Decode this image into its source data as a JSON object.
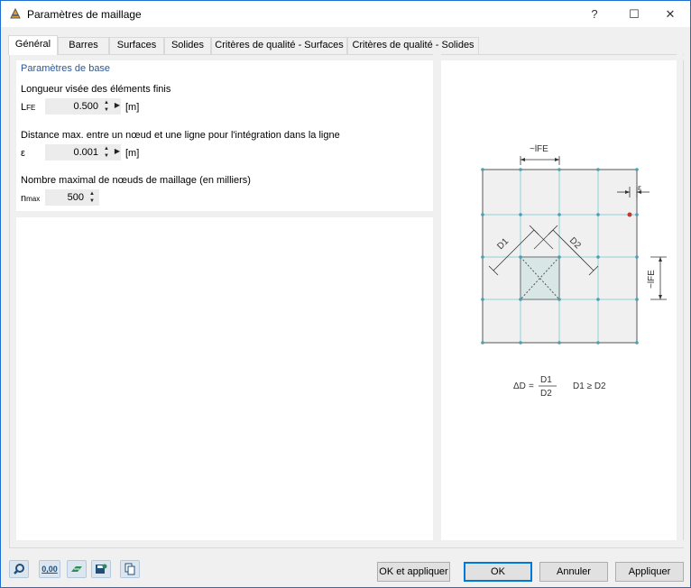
{
  "window": {
    "title": "Paramètres de maillage"
  },
  "titlebar": {
    "help": "?",
    "maximize": "☐",
    "close": "✕"
  },
  "tabs": [
    {
      "label": "Général",
      "active": true
    },
    {
      "label": "Barres"
    },
    {
      "label": "Surfaces"
    },
    {
      "label": "Solides"
    },
    {
      "label": "Critères de qualité - Surfaces"
    },
    {
      "label": "Critères de qualité - Solides"
    }
  ],
  "basic": {
    "section_title": "Paramètres de base",
    "target_length": {
      "label": "Longueur visée des éléments finis",
      "symbol": "L",
      "symbol_sub": "FE",
      "value": "0.500",
      "unit": "[m]"
    },
    "max_distance": {
      "label": "Distance max. entre un nœud et une ligne pour l'intégration dans la ligne",
      "symbol": "ε",
      "value": "0.001",
      "unit": "[m]"
    },
    "max_nodes": {
      "label": "Nombre maximal de nœuds de maillage (en milliers)",
      "symbol": "n",
      "symbol_sub": "max",
      "value": "500"
    }
  },
  "diagram": {
    "lfe_top": "~lFE",
    "lfe_side": "~lFE",
    "epsilon": "ε",
    "d1": "D1",
    "d2": "D2",
    "formula_lhs": "ΔD",
    "formula_eq": "=",
    "formula_num": "D1",
    "formula_den": "D2",
    "formula_cond": "D1 ≥ D2"
  },
  "footer": {
    "icons": [
      "search-icon",
      "numeric-format-icon",
      "view-icon",
      "save-icon",
      "copy-icon"
    ],
    "numeric_icon_text": "0,00",
    "buttons": {
      "ok_apply": "OK et appliquer",
      "ok": "OK",
      "cancel": "Annuler",
      "apply": "Appliquer"
    }
  },
  "colors": {
    "accent": "#0078d7",
    "section_title": "#2b579a",
    "mesh_line": "#7ec8d2",
    "node": "#4a9fb0",
    "marker": "#c0392b"
  }
}
